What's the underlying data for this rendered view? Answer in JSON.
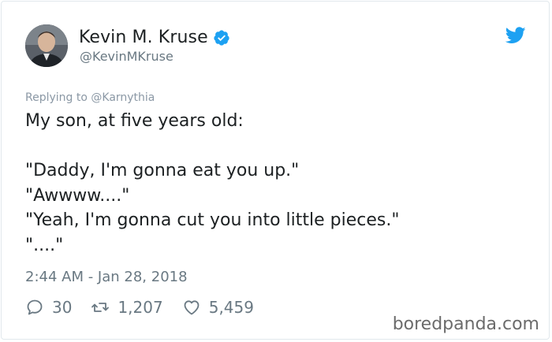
{
  "author": {
    "display_name": "Kevin M. Kruse",
    "handle": "@KevinMKruse",
    "verified": true,
    "avatar_icon": "profile-photo"
  },
  "tweet": {
    "reply_to": "Replying to @Karnythia",
    "lines": [
      "My son, at five years old:",
      "",
      "\"Daddy, I'm gonna eat you up.\"",
      "\"Awwww....\"",
      "\"Yeah, I'm gonna cut you into little pieces.\"",
      "\"....\""
    ],
    "timestamp": "2:44 AM - Jan 28, 2018"
  },
  "actions": {
    "replies": "30",
    "retweets": "1,207",
    "likes": "5,459"
  },
  "watermark": "boredpanda.com",
  "colors": {
    "verified_blue": "#1da1f2",
    "twitter_blue": "#1da1f2",
    "muted_text": "#697882",
    "body_text": "#1c2022"
  }
}
